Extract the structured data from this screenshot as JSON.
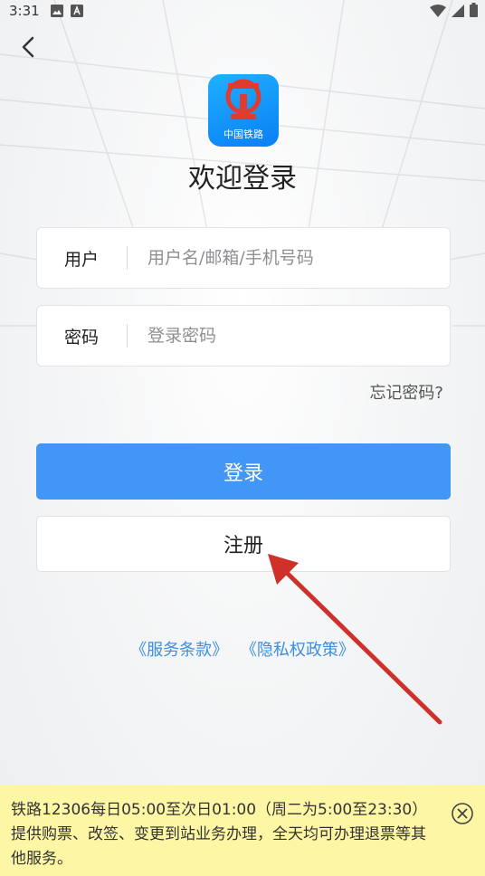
{
  "status_bar": {
    "time": "3:31"
  },
  "logo": {
    "text": "中国铁路"
  },
  "welcome_title": "欢迎登录",
  "username_field": {
    "label": "用户",
    "placeholder": "用户名/邮箱/手机号码"
  },
  "password_field": {
    "label": "密码",
    "placeholder": "登录密码"
  },
  "forgot_password": "忘记密码?",
  "login_button": "登录",
  "register_button": "注册",
  "links": {
    "terms": "《服务条款》",
    "privacy": "《隐私权政策》"
  },
  "notice": {
    "text": "铁路12306每日05:00至次日01:00（周二为5:00至23:30）提供购票、改签、变更到站业务办理，全天均可办理退票等其他服务。"
  },
  "colors": {
    "primary": "#4196f7",
    "link": "#3c8fe0",
    "notice_bg": "#fdf6a5",
    "annotation_arrow": "#d0302a"
  }
}
